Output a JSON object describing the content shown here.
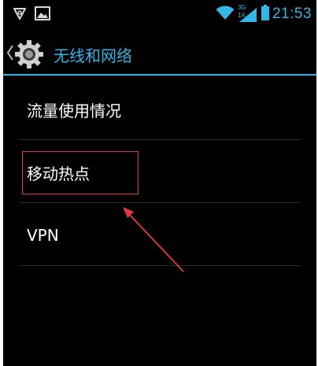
{
  "status_bar": {
    "time": "21:53",
    "network_badge_top": "3G",
    "network_badge_bottom": "1X",
    "icons": [
      "notification-triangle-icon",
      "image-icon",
      "wifi-icon",
      "cell-signal-icon",
      "battery-icon"
    ]
  },
  "action_bar": {
    "title": "无线和网络",
    "icon": "settings-gear-icon"
  },
  "list": {
    "items": [
      {
        "label": "流量使用情况"
      },
      {
        "label": "移动热点"
      },
      {
        "label": "VPN"
      }
    ]
  },
  "colors": {
    "accent": "#33b5e5",
    "background": "#000000",
    "text": "#ffffff",
    "annotation": "#e0363c"
  }
}
